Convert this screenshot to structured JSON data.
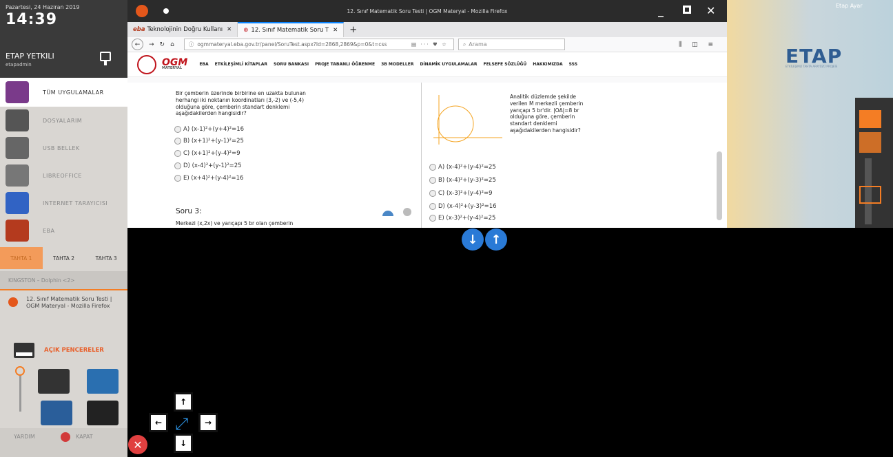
{
  "side": {
    "date": "Pazartesi, 24 Haziran 2019",
    "time": "14:39",
    "user_name": "ETAP YETKILI",
    "user_login": "etapadmin",
    "apps": [
      {
        "label": "TÜM UYGULAMALAR",
        "color": "#7a3a8a"
      },
      {
        "label": "DOSYALARIM",
        "color": "#555"
      },
      {
        "label": "USB BELLEK",
        "color": "#666"
      },
      {
        "label": "LIBREOFFICE",
        "color": "#777"
      },
      {
        "label": "INTERNET TARAYICISI",
        "color": "#3163c4"
      },
      {
        "label": "EBA",
        "color": "#b43a1e"
      }
    ],
    "tahta": [
      "TAHTA 1",
      "TAHTA 2",
      "TAHTA 3"
    ],
    "usb_device": "KINGSTON – Dolphin <2>",
    "open_window": "12. Sınıf Matematik Soru Testi | OGM Materyal - Mozilla Firefox",
    "open_windows_label": "AÇIK PENCERELER",
    "help": "YARDIM",
    "shutdown": "KAPAT"
  },
  "browser": {
    "title": "12. Sınıf Matematik Soru Testi | OGM Materyal - Mozilla Firefox",
    "tabs": [
      "Teknolojinin Doğru Kullanı",
      "12. Sınıf Matematik Soru T"
    ],
    "url": "ogmmateryal.eba.gov.tr/panel/SoruTest.aspx?Id=2868,2869&p=0&t=css",
    "search_placeholder": "Arama"
  },
  "site": {
    "logo": "OGM",
    "logo_sub": "MATERYAL",
    "nav": [
      "EBA",
      "ETKİLEŞİMLİ KİTAPLAR",
      "SORU BANKASI",
      "PROJE TABANLI ÖĞRENME",
      "3B MODELLER",
      "DİNAMİK UYGULAMALAR",
      "FELSEFE SÖZLÜĞÜ",
      "HAKKIMIZDA",
      "SSS"
    ]
  },
  "q1": {
    "text": "Bir çemberin üzerinde birbirine en uzakta bulunan herhangi iki noktanın koordinatları (3,-2) ve (-5,4) olduğuna göre, çemberin standart denklemi aşağıdakilerden hangisidir?",
    "options": [
      "A) (x-1)²+(y+4)²=16",
      "B) (x+1)²+(y-1)²=25",
      "C) (x+1)²+(y-4)²=9",
      "D) (x-4)²+(y-1)²=25",
      "E) (x+4)²+(y-4)²=16"
    ]
  },
  "q2": {
    "text": "Analitik düzlemde şekilde verilen M merkezli çemberin yarıçapı 5 br'dir. |OA|=8 br olduğuna göre, çemberin standart denklemi aşağıdakilerden hangisidir?",
    "options": [
      "A) (x-4)²+(y-4)²=25",
      "B) (x-4)²+(y-3)²=25",
      "C) (x-3)²+(y-4)²=9",
      "D) (x-4)²+(y-3)²=16",
      "E) (x-3)²+(y-4)²=25"
    ]
  },
  "q3": {
    "title": "Soru 3:",
    "text": "Merkezi (x,2x) ve yarıçapı 5 br olan çemberin"
  },
  "right": {
    "brand": "ETAP",
    "brand_sub": "ETKİLEŞİMLİ TAHTA ARAYÜZÜ PROJESİ",
    "settings": "Etap Ayar"
  }
}
